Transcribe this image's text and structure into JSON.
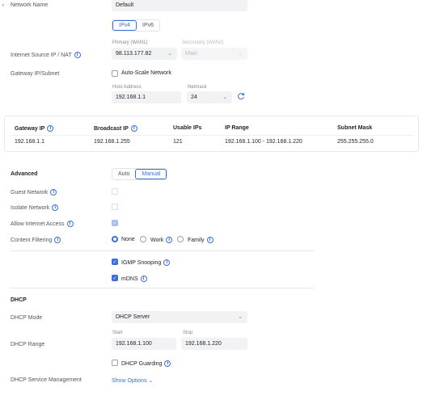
{
  "network_name": {
    "label": "Network Name",
    "value": "Default"
  },
  "ip_version": {
    "tabs": [
      "IPv4",
      "IPv6"
    ],
    "selected": "IPv4"
  },
  "internet_source": {
    "label": "Internet Source IP / NAT",
    "primary_label": "Primary (WAN1)",
    "primary_value": "98.113.177.82",
    "secondary_label": "Secondary (WAN2)",
    "secondary_value": "Main"
  },
  "gateway": {
    "label": "Gateway IP/Subnet",
    "auto_scale_label": "Auto-Scale Network",
    "host_label": "Host Address",
    "host_value": "192.168.1.1",
    "netmask_label": "Netmask",
    "netmask_value": "24"
  },
  "summary_table": {
    "headers": [
      "Gateway IP",
      "Broadcast IP",
      "Usable IPs",
      "IP Range",
      "Subnet Mask"
    ],
    "row": [
      "192.168.1.1",
      "192.168.1.255",
      "121",
      "192.168.1.100 - 192.168.1.220",
      "255.255.255.0"
    ]
  },
  "advanced": {
    "label": "Advanced",
    "tabs": [
      "Auto",
      "Manual"
    ],
    "selected": "Manual",
    "guest_network": "Guest Network",
    "isolate_network": "Isolate Network",
    "allow_internet": "Allow Internet Access",
    "content_filtering": "Content Filtering",
    "filter_options": [
      "None",
      "Work",
      "Family"
    ],
    "filter_selected": "None",
    "igmp": "IGMP Snooping",
    "mdns": "mDNS"
  },
  "dhcp": {
    "section": "DHCP",
    "mode_label": "DHCP Mode",
    "mode_value": "DHCP Server",
    "range_label": "DHCP Range",
    "start_label": "Start",
    "start_value": "192.168.1.100",
    "stop_label": "Stop",
    "stop_value": "192.168.1.220",
    "guarding_label": "DHCP Guarding",
    "service_label": "DHCP Service Management",
    "show_options": "Show Options"
  },
  "colors": {
    "accent": "#3a6fd8",
    "field_bg": "#f1f2f4",
    "text": "#212327",
    "muted": "#50565e"
  }
}
